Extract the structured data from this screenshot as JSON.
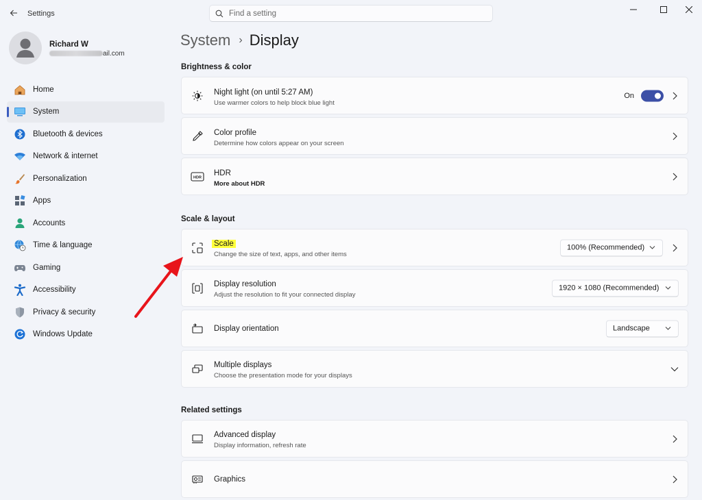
{
  "window": {
    "title": "Settings"
  },
  "search": {
    "placeholder": "Find a setting"
  },
  "profile": {
    "name": "Richard W",
    "email_visible_suffix": "ail.com"
  },
  "sidebar": {
    "items": [
      {
        "label": "Home",
        "icon": "home-icon"
      },
      {
        "label": "System",
        "icon": "system-icon",
        "active": true
      },
      {
        "label": "Bluetooth & devices",
        "icon": "bluetooth-icon"
      },
      {
        "label": "Network & internet",
        "icon": "wifi-icon"
      },
      {
        "label": "Personalization",
        "icon": "brush-icon"
      },
      {
        "label": "Apps",
        "icon": "apps-icon"
      },
      {
        "label": "Accounts",
        "icon": "accounts-icon"
      },
      {
        "label": "Time & language",
        "icon": "globe-clock-icon"
      },
      {
        "label": "Gaming",
        "icon": "gamepad-icon"
      },
      {
        "label": "Accessibility",
        "icon": "accessibility-icon"
      },
      {
        "label": "Privacy & security",
        "icon": "shield-icon"
      },
      {
        "label": "Windows Update",
        "icon": "update-icon"
      }
    ]
  },
  "breadcrumb": {
    "parent": "System",
    "separator": "›",
    "current": "Display"
  },
  "sections": {
    "brightness": "Brightness & color",
    "scale_layout": "Scale & layout",
    "related": "Related settings"
  },
  "cards": {
    "night_light": {
      "title": "Night light (on until 5:27 AM)",
      "subtitle": "Use warmer colors to help block blue light",
      "toggle_label": "On",
      "toggle_on": true
    },
    "color_profile": {
      "title": "Color profile",
      "subtitle": "Determine how colors appear on your screen"
    },
    "hdr": {
      "title": "HDR",
      "subtitle": "More about HDR"
    },
    "scale": {
      "title": "Scale",
      "subtitle": "Change the size of text, apps, and other items",
      "value": "100% (Recommended)"
    },
    "resolution": {
      "title": "Display resolution",
      "subtitle": "Adjust the resolution to fit your connected display",
      "value": "1920 × 1080 (Recommended)"
    },
    "orientation": {
      "title": "Display orientation",
      "value": "Landscape"
    },
    "multiple": {
      "title": "Multiple displays",
      "subtitle": "Choose the presentation mode for your displays"
    },
    "advanced": {
      "title": "Advanced display",
      "subtitle": "Display information, refresh rate"
    },
    "graphics": {
      "title": "Graphics"
    }
  },
  "colors": {
    "accent": "#3c4fa6",
    "highlight": "#ffff3b",
    "annotation_arrow": "#e8141b"
  }
}
